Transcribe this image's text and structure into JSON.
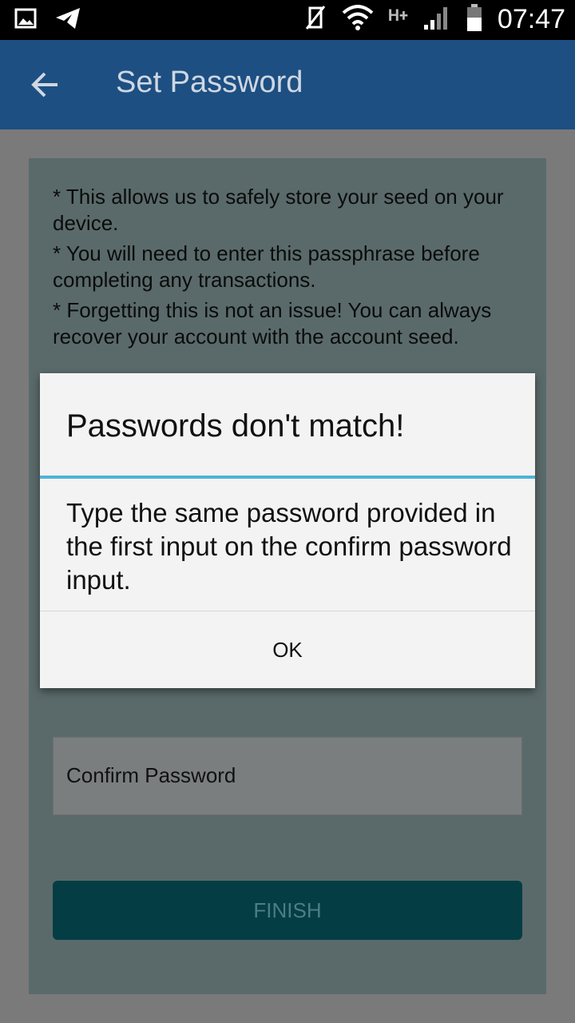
{
  "status_bar": {
    "time": "07:47",
    "network": "H+",
    "icons": [
      "image-icon",
      "telegram-icon",
      "mute-icon",
      "wifi-icon",
      "signal-icon",
      "battery-icon"
    ]
  },
  "app_bar": {
    "title": "Set Password",
    "back_icon": "arrow-left-icon"
  },
  "info": {
    "line1": "* This allows us to safely store your seed on your device.",
    "line2": "* You will need to enter this passphrase before completing any transactions.",
    "line3": "* Forgetting this is not an issue! You can always recover your account with the account seed."
  },
  "form": {
    "confirm_placeholder": "Confirm Password",
    "finish_label": "FINISH"
  },
  "dialog": {
    "title": "Passwords don't match!",
    "message": "Type the same password provided in the first input on the confirm password input.",
    "ok_label": "OK"
  },
  "colors": {
    "appbar": "#1d4f82",
    "accent_line": "#4fb3d9",
    "finish_bg": "#053d45"
  }
}
